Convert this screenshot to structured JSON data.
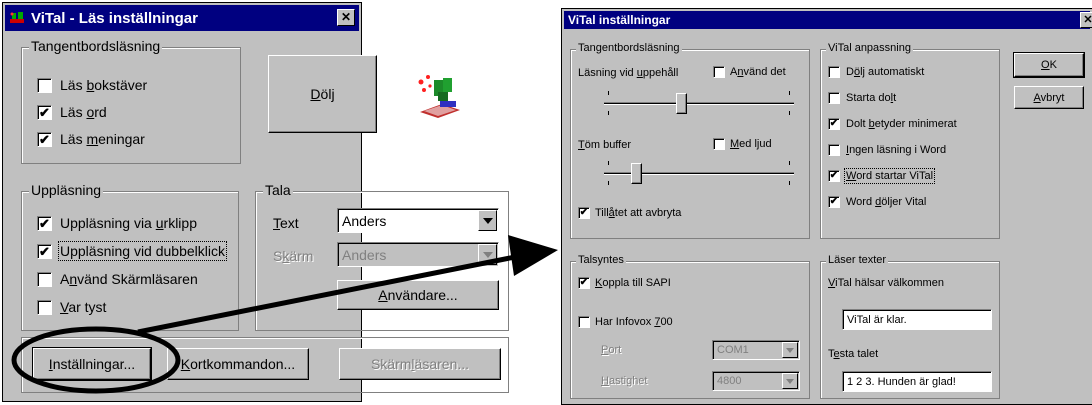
{
  "left_window": {
    "title": "ViTal - Läs inställningar",
    "close_glyph": "✕",
    "keyboard_group": {
      "legend": "Tangentbordsläsning",
      "items": [
        {
          "pre": "Läs ",
          "key": "b",
          "post": "okstäver",
          "checked": false
        },
        {
          "pre": "Läs ",
          "key": "o",
          "post": "rd",
          "checked": true
        },
        {
          "pre": "Läs ",
          "key": "m",
          "post": "eningar",
          "checked": true
        }
      ]
    },
    "hide_button": {
      "key": "D",
      "post": "ölj"
    },
    "reading_group": {
      "legend": "Uppläsning",
      "items": [
        {
          "pre": "Uppläsning via ",
          "key": "u",
          "post": "rklipp",
          "checked": true
        },
        {
          "pre": "Uppläsning vid dubbelklick",
          "key": "",
          "post": "",
          "checked": true
        },
        {
          "pre": "A",
          "key": "n",
          "post": "vänd Skärmläsaren",
          "checked": false
        },
        {
          "pre": "",
          "key": "V",
          "post": "ar tyst",
          "checked": false
        }
      ]
    },
    "speak_group": {
      "legend": "Tala",
      "text_label": {
        "key": "T",
        "post": "ext"
      },
      "text_value": "Anders",
      "screen_label": {
        "pre": "S",
        "key": "k",
        "post": "ärm"
      },
      "screen_value": "Anders",
      "users_button": {
        "key": "A",
        "post": "nvändare..."
      }
    },
    "bottom_buttons": {
      "settings": {
        "key": "I",
        "post": "nställningar..."
      },
      "shortcuts": {
        "key": "K",
        "post": "ortkommandon..."
      },
      "screenreader": {
        "pre": "Skärm",
        "key": "l",
        "post": "äsaren..."
      }
    }
  },
  "right_window": {
    "title": "ViTal inställningar",
    "close_glyph": "✕",
    "keyboard_group": {
      "legend": "Tangentbordsläsning",
      "pause_label": {
        "pre": "Läsning vid ",
        "key": "u",
        "post": "ppehåll"
      },
      "use_it": {
        "pre": "A",
        "key": "n",
        "post": "vänd det",
        "checked": false
      },
      "pause_slider": 0.4,
      "clear_buffer_label": {
        "pre": "",
        "key": "T",
        "post": "öm buffer"
      },
      "with_sound": {
        "pre": "",
        "key": "M",
        "post": "ed ljud",
        "checked": false
      },
      "buffer_slider": 0.15,
      "allow_interrupt": {
        "pre": "Till",
        "key": "å",
        "post": "tet att avbryta",
        "checked": true
      }
    },
    "adapt_group": {
      "legend": "ViTal anpassning",
      "items": [
        {
          "pre": "D",
          "key": "ö",
          "post": "lj automatiskt",
          "checked": false
        },
        {
          "pre": "Starta do",
          "key": "l",
          "post": "t",
          "checked": false
        },
        {
          "pre": "Dolt ",
          "key": "b",
          "post": "etyder minimerat",
          "checked": true
        },
        {
          "pre": "",
          "key": "I",
          "post": "ngen läsning i Word",
          "checked": false
        },
        {
          "pre": "",
          "key": "W",
          "post": "ord startar ViTal",
          "checked": true,
          "focused": true
        },
        {
          "pre": "Word ",
          "key": "d",
          "post": "öljer Vital",
          "checked": true
        }
      ]
    },
    "ok_button": {
      "key": "O",
      "post": "K"
    },
    "cancel_button": {
      "key": "A",
      "post": "vbryt"
    },
    "synth_group": {
      "legend": "Talsyntes",
      "sapi": {
        "pre": "",
        "key": "K",
        "post": "oppla till SAPI",
        "checked": true
      },
      "infovox": {
        "pre": "Har Infovox ",
        "key": "7",
        "post": "00",
        "checked": false
      },
      "port_label": {
        "key": "P",
        "post": "ort"
      },
      "port_value": "COM1",
      "speed_label": {
        "key": "H",
        "post": "astighet"
      },
      "speed_value": "4800"
    },
    "texts_group": {
      "legend": "Läser texter",
      "welcome_label": {
        "key": "V",
        "post": "iTal hälsar välkommen"
      },
      "welcome_value": "ViTal är klar.",
      "test_label": {
        "pre": "T",
        "key": "e",
        "post": "sta talet"
      },
      "test_value": "1 2 3. Hunden är glad!"
    }
  },
  "colors": {
    "face": "#c0c0c0",
    "titlebar": "#000080",
    "arrow": "#000000"
  }
}
